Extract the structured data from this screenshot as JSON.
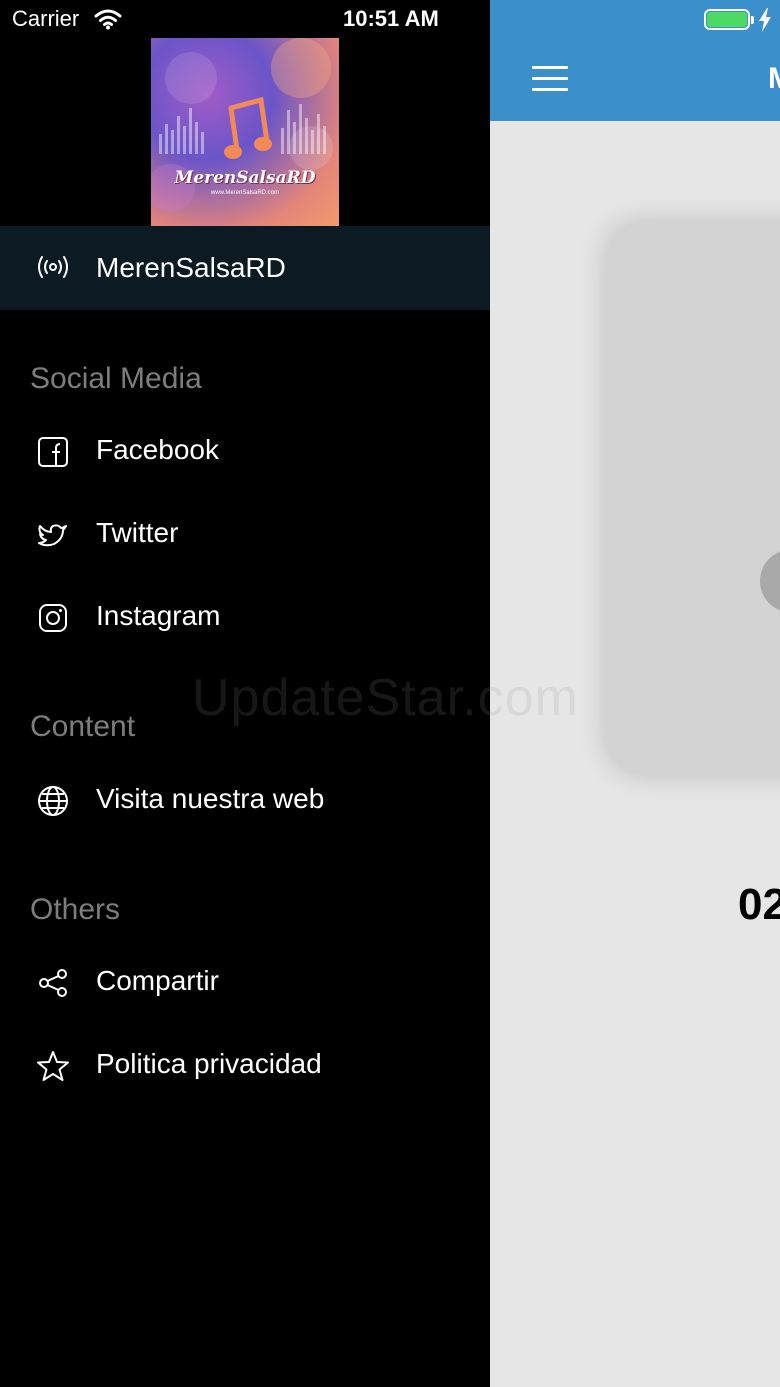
{
  "status_bar": {
    "carrier": "Carrier",
    "time": "10:51 AM",
    "battery_color": "#4cd964"
  },
  "app_bar": {
    "title_fragment": "M",
    "color": "#3b8fcb"
  },
  "main": {
    "time_fragment": "02"
  },
  "drawer": {
    "logo": {
      "title": "MerenSalsaRD",
      "url_text": "www.MerenSalsaRD.com"
    },
    "station": {
      "label": "MerenSalsaRD",
      "icon": "radio-broadcast-icon"
    },
    "sections": [
      {
        "title": "Social Media",
        "items": [
          {
            "label": "Facebook",
            "icon": "facebook-icon"
          },
          {
            "label": "Twitter",
            "icon": "twitter-icon"
          },
          {
            "label": "Instagram",
            "icon": "instagram-icon"
          }
        ]
      },
      {
        "title": "Content",
        "items": [
          {
            "label": "Visita nuestra web",
            "icon": "globe-icon"
          }
        ]
      },
      {
        "title": "Others",
        "items": [
          {
            "label": "Compartir",
            "icon": "share-icon"
          },
          {
            "label": "Politica privacidad",
            "icon": "star-icon"
          }
        ]
      }
    ]
  },
  "watermark": "UpdateStar.com"
}
